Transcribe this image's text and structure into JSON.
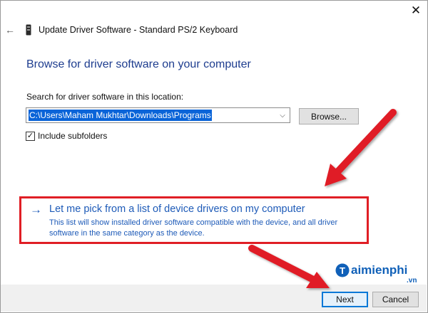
{
  "window": {
    "close_glyph": "✕",
    "title": "Update Driver Software - Standard PS/2 Keyboard",
    "back_glyph": "←",
    "back_icon": "back-arrow-icon",
    "device_icon": "keyboard-device-icon"
  },
  "main": {
    "heading": "Browse for driver software on your computer",
    "location_label": "Search for driver software in this location:",
    "path_value": "C:\\Users\\Maham Mukhtar\\Downloads\\Programs",
    "dropdown_glyph": "⌵",
    "browse_label": "Browse...",
    "include_subfolders": {
      "checked": true,
      "check_glyph": "✓",
      "label": "Include subfolders"
    }
  },
  "pick_option": {
    "arrow_glyph": "→",
    "title": "Let me pick from a list of device drivers on my computer",
    "description": "This list will show installed driver software compatible with the device, and all driver software in the same category as the device."
  },
  "footer": {
    "next_label": "Next",
    "cancel_label": "Cancel"
  },
  "watermark": {
    "brand": "aimienphi",
    "logo_letter": "T",
    "suffix": ".vn"
  },
  "colors": {
    "link_blue": "#1e5bb8",
    "heading_blue": "#1e3d8f",
    "annotation_red": "#e01e25",
    "selection_blue": "#0a64d8"
  }
}
